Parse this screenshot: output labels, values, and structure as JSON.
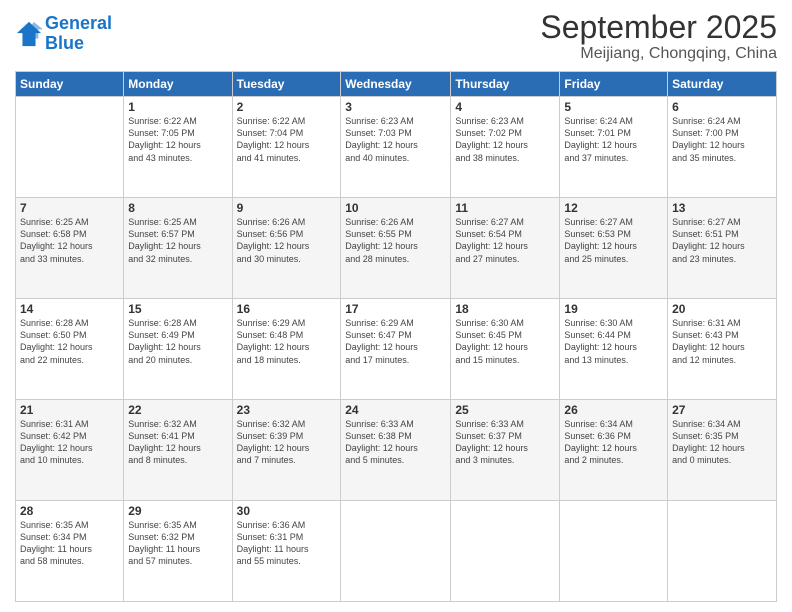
{
  "header": {
    "logo_line1": "General",
    "logo_line2": "Blue",
    "month": "September 2025",
    "location": "Meijiang, Chongqing, China"
  },
  "weekdays": [
    "Sunday",
    "Monday",
    "Tuesday",
    "Wednesday",
    "Thursday",
    "Friday",
    "Saturday"
  ],
  "weeks": [
    [
      {
        "day": "",
        "info": ""
      },
      {
        "day": "1",
        "info": "Sunrise: 6:22 AM\nSunset: 7:05 PM\nDaylight: 12 hours\nand 43 minutes."
      },
      {
        "day": "2",
        "info": "Sunrise: 6:22 AM\nSunset: 7:04 PM\nDaylight: 12 hours\nand 41 minutes."
      },
      {
        "day": "3",
        "info": "Sunrise: 6:23 AM\nSunset: 7:03 PM\nDaylight: 12 hours\nand 40 minutes."
      },
      {
        "day": "4",
        "info": "Sunrise: 6:23 AM\nSunset: 7:02 PM\nDaylight: 12 hours\nand 38 minutes."
      },
      {
        "day": "5",
        "info": "Sunrise: 6:24 AM\nSunset: 7:01 PM\nDaylight: 12 hours\nand 37 minutes."
      },
      {
        "day": "6",
        "info": "Sunrise: 6:24 AM\nSunset: 7:00 PM\nDaylight: 12 hours\nand 35 minutes."
      }
    ],
    [
      {
        "day": "7",
        "info": "Sunrise: 6:25 AM\nSunset: 6:58 PM\nDaylight: 12 hours\nand 33 minutes."
      },
      {
        "day": "8",
        "info": "Sunrise: 6:25 AM\nSunset: 6:57 PM\nDaylight: 12 hours\nand 32 minutes."
      },
      {
        "day": "9",
        "info": "Sunrise: 6:26 AM\nSunset: 6:56 PM\nDaylight: 12 hours\nand 30 minutes."
      },
      {
        "day": "10",
        "info": "Sunrise: 6:26 AM\nSunset: 6:55 PM\nDaylight: 12 hours\nand 28 minutes."
      },
      {
        "day": "11",
        "info": "Sunrise: 6:27 AM\nSunset: 6:54 PM\nDaylight: 12 hours\nand 27 minutes."
      },
      {
        "day": "12",
        "info": "Sunrise: 6:27 AM\nSunset: 6:53 PM\nDaylight: 12 hours\nand 25 minutes."
      },
      {
        "day": "13",
        "info": "Sunrise: 6:27 AM\nSunset: 6:51 PM\nDaylight: 12 hours\nand 23 minutes."
      }
    ],
    [
      {
        "day": "14",
        "info": "Sunrise: 6:28 AM\nSunset: 6:50 PM\nDaylight: 12 hours\nand 22 minutes."
      },
      {
        "day": "15",
        "info": "Sunrise: 6:28 AM\nSunset: 6:49 PM\nDaylight: 12 hours\nand 20 minutes."
      },
      {
        "day": "16",
        "info": "Sunrise: 6:29 AM\nSunset: 6:48 PM\nDaylight: 12 hours\nand 18 minutes."
      },
      {
        "day": "17",
        "info": "Sunrise: 6:29 AM\nSunset: 6:47 PM\nDaylight: 12 hours\nand 17 minutes."
      },
      {
        "day": "18",
        "info": "Sunrise: 6:30 AM\nSunset: 6:45 PM\nDaylight: 12 hours\nand 15 minutes."
      },
      {
        "day": "19",
        "info": "Sunrise: 6:30 AM\nSunset: 6:44 PM\nDaylight: 12 hours\nand 13 minutes."
      },
      {
        "day": "20",
        "info": "Sunrise: 6:31 AM\nSunset: 6:43 PM\nDaylight: 12 hours\nand 12 minutes."
      }
    ],
    [
      {
        "day": "21",
        "info": "Sunrise: 6:31 AM\nSunset: 6:42 PM\nDaylight: 12 hours\nand 10 minutes."
      },
      {
        "day": "22",
        "info": "Sunrise: 6:32 AM\nSunset: 6:41 PM\nDaylight: 12 hours\nand 8 minutes."
      },
      {
        "day": "23",
        "info": "Sunrise: 6:32 AM\nSunset: 6:39 PM\nDaylight: 12 hours\nand 7 minutes."
      },
      {
        "day": "24",
        "info": "Sunrise: 6:33 AM\nSunset: 6:38 PM\nDaylight: 12 hours\nand 5 minutes."
      },
      {
        "day": "25",
        "info": "Sunrise: 6:33 AM\nSunset: 6:37 PM\nDaylight: 12 hours\nand 3 minutes."
      },
      {
        "day": "26",
        "info": "Sunrise: 6:34 AM\nSunset: 6:36 PM\nDaylight: 12 hours\nand 2 minutes."
      },
      {
        "day": "27",
        "info": "Sunrise: 6:34 AM\nSunset: 6:35 PM\nDaylight: 12 hours\nand 0 minutes."
      }
    ],
    [
      {
        "day": "28",
        "info": "Sunrise: 6:35 AM\nSunset: 6:34 PM\nDaylight: 11 hours\nand 58 minutes."
      },
      {
        "day": "29",
        "info": "Sunrise: 6:35 AM\nSunset: 6:32 PM\nDaylight: 11 hours\nand 57 minutes."
      },
      {
        "day": "30",
        "info": "Sunrise: 6:36 AM\nSunset: 6:31 PM\nDaylight: 11 hours\nand 55 minutes."
      },
      {
        "day": "",
        "info": ""
      },
      {
        "day": "",
        "info": ""
      },
      {
        "day": "",
        "info": ""
      },
      {
        "day": "",
        "info": ""
      }
    ]
  ]
}
